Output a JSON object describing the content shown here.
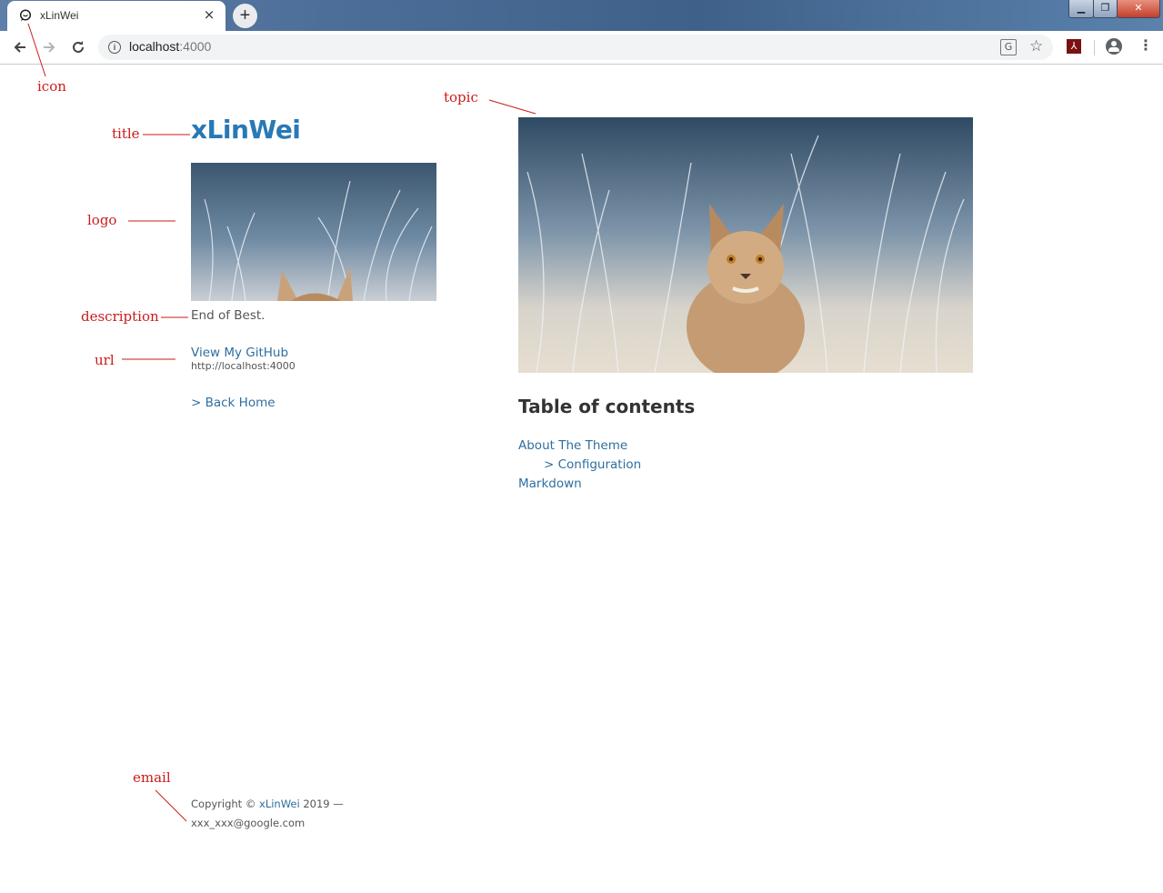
{
  "browser": {
    "tab_title": "xLinWei",
    "tab_close": "×",
    "new_tab": "+",
    "url_host": "localhost",
    "url_port": ":4000",
    "window_controls": {
      "minimize": "▁",
      "maximize": "❐",
      "close": "✕"
    }
  },
  "page": {
    "title": "xLinWei",
    "description": "End of Best.",
    "github_link": "View My GitHub",
    "site_url": "http://localhost:4000",
    "back_home": "> Back Home",
    "toc_heading": "Table of contents",
    "toc_items": [
      {
        "label": "About The Theme"
      },
      {
        "label": "> Configuration"
      },
      {
        "label": "Markdown"
      }
    ],
    "footer": {
      "copyright_prefix": "Copyright ©",
      "author": "xLinWei",
      "year_suffix": "2019 —",
      "email": "xxx_xxx@google.com"
    }
  },
  "annotations": {
    "icon": "icon",
    "title": "title",
    "logo": "logo",
    "description": "description",
    "url": "url",
    "topic": "topic",
    "email": "email",
    "color": "#cc1a1a"
  },
  "icons": [
    "chat-bubble-icon",
    "back-arrow-icon",
    "forward-arrow-icon",
    "reload-icon",
    "info-icon",
    "translate-icon",
    "star-icon",
    "pdf-icon",
    "profile-icon",
    "menu-icon"
  ]
}
